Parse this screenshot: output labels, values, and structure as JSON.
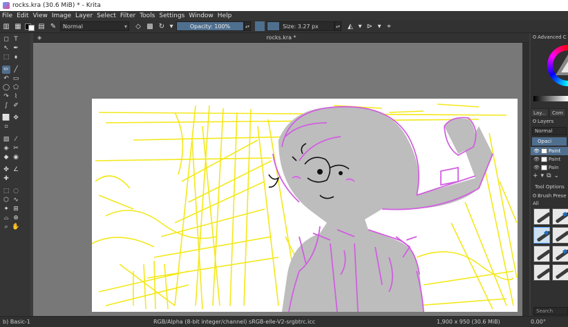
{
  "window": {
    "title": "rocks.kra (30.6 MiB)  * - Krita"
  },
  "menu": {
    "items": [
      "File",
      "Edit",
      "View",
      "Image",
      "Layer",
      "Select",
      "Filter",
      "Tools",
      "Settings",
      "Window",
      "Help"
    ]
  },
  "toolbar": {
    "blend_mode": "Normal",
    "opacity": "Opacity: 100%",
    "size": "Size: 3.27 px",
    "size_fill_pct": 18
  },
  "document": {
    "tab_title": "rocks.kra *"
  },
  "docker": {
    "color_title": "Advanced C",
    "tabs": [
      "Lay...",
      "Com"
    ],
    "layers_title": "Layers",
    "blend_mode": "Normal",
    "opacity_label": "Opaci",
    "layers": [
      {
        "name": "Paint",
        "active": true
      },
      {
        "name": "Paint",
        "active": false
      },
      {
        "name": "Pain",
        "active": false
      }
    ],
    "tool_options": "Tool Options",
    "brush_presets": "Brush Prese",
    "preset_filter": "All",
    "search_placeholder": "Search"
  },
  "status": {
    "preset": "b) Basic-1",
    "color_space": "RGB/Alpha (8-bit integer/channel)  sRGB-elle-V2-srgbtrc.icc",
    "dimensions": "1,900 x 950 (30.6 MiB)",
    "rotation": "0.00°"
  },
  "colors": {
    "accent": "#4f6f8f",
    "sketch_yellow": "#f2e600",
    "sketch_purple": "#d15ee0",
    "fill_gray": "#bdbdbd"
  }
}
